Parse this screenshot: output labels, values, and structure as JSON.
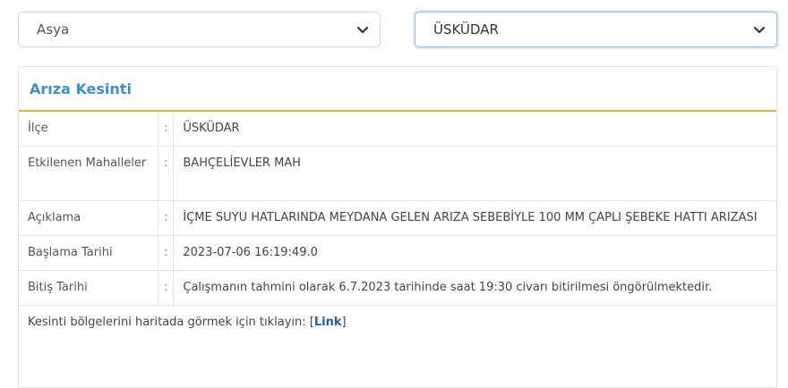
{
  "filters": {
    "region": "Asya",
    "district": "ÜSKÜDAR"
  },
  "panel": {
    "title": "Arıza Kesinti",
    "rows": [
      {
        "label": "İlçe",
        "sep": ":",
        "value": "ÜSKÜDAR"
      },
      {
        "label": "Etkilenen Mahalleler",
        "sep": ":",
        "value": "BAHÇELİEVLER MAH"
      },
      {
        "label": "Açıklama",
        "sep": ":",
        "value": "İÇME SUYU HATLARINDA MEYDANA GELEN ARIZA SEBEBİYLE 100 MM ÇAPLI ŞEBEKE HATTI ARIZASI"
      },
      {
        "label": "Başlama Tarihi",
        "sep": ":",
        "value": "2023-07-06 16:19:49.0"
      },
      {
        "label": "Bitiş Tarihi",
        "sep": ":",
        "value": "Çalışmanın tahmini olarak 6.7.2023 tarihinde saat 19:30 civarı bitirilmesi öngörülmektedir."
      }
    ],
    "footer_text": "Kesinti bölgelerini haritada görmek için tıklayın: [",
    "footer_link": "Link",
    "footer_close": "]"
  },
  "colors": {
    "title": "#3a90c8",
    "accent_border": "#e9b52c",
    "link": "#2a5d92"
  },
  "icons": {
    "dropdown": "chevron-down-icon"
  }
}
